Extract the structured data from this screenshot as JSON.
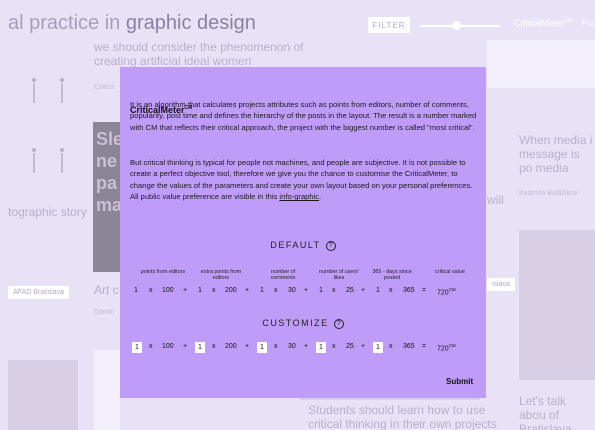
{
  "background": {
    "title_a": "al practice in ",
    "title_b": "graphic design",
    "filter_label": "FILTER",
    "criticalmeter_link": "CriticalMeter",
    "criticalmeter_sup": "CM",
    "pu_link": "Pu",
    "snippet_top": "we should consider the phenomenon of creating artificial ideal women",
    "snippet_critica": "Critica",
    "snippet_topographic": "tographic story",
    "snippet_dark_card": "Sle ne pa ma",
    "tag_afad": "AFAD Bratislava",
    "snippet_art": "Art c",
    "snippet_domin": "Domin",
    "snippet_right_media": "When media i message is po media",
    "snippet_author": "Katarína Balážikov",
    "snippet_will": "will",
    "tag_islava": "islava",
    "snippet_students": "Students should learn how to use critical thinking in their own projects",
    "snippet_lets_talk": "Let's talk abou of Bratislava"
  },
  "modal": {
    "title": "CriticalMeter",
    "title_sup": "CM",
    "paragraph1": "It is an algorithm that calculates projects attributes such as points from editors, number of comments, popularity, post time and defines the hierarchy of the posts in the layout. The result is a number marked with CM that reflects their critical approach, the project with the biggest number is called \"most critical\".",
    "paragraph2_text": "But critical thinking is typical for people not machines, and people are subjective. It is not possible to create a perfect objective tool, therefore we give you the chance to customise the CriticalMeter, to change the values of the parameters and create your own layout based on your personal preferences. All public value preference are visible in this ",
    "paragraph2_link": "info-graphic",
    "paragraph2_end": ".",
    "default_heading": "DEFAULT",
    "customize_heading": "CUSTOMIZE",
    "help_glyph": "?",
    "columns": [
      "points from editors",
      "extra points from editors",
      "number of comments",
      "number of users' likes",
      "365 - days since posted",
      "critical value"
    ],
    "default_formula": {
      "w1": "1",
      "v1": "100",
      "w2": "1",
      "v2": "200",
      "w3": "1",
      "v3": "30",
      "w4": "1",
      "v4": "25",
      "w5": "1",
      "v5": "365",
      "result": "720",
      "result_sup": "CM"
    },
    "customize_formula": {
      "w1": "1",
      "v1": "100",
      "w2": "1",
      "v2": "200",
      "w3": "1",
      "v3": "30",
      "w4": "1",
      "v4": "25",
      "w5": "1",
      "v5": "365",
      "result": "720",
      "result_sup": "CM"
    },
    "op_times": "x",
    "op_plus": "+",
    "op_equals": "=",
    "submit_label": "Submit"
  },
  "colors": {
    "modal_bg": "#c09cf9",
    "page_bg": "#e9e2f6",
    "input_bg": "#ffffff"
  }
}
